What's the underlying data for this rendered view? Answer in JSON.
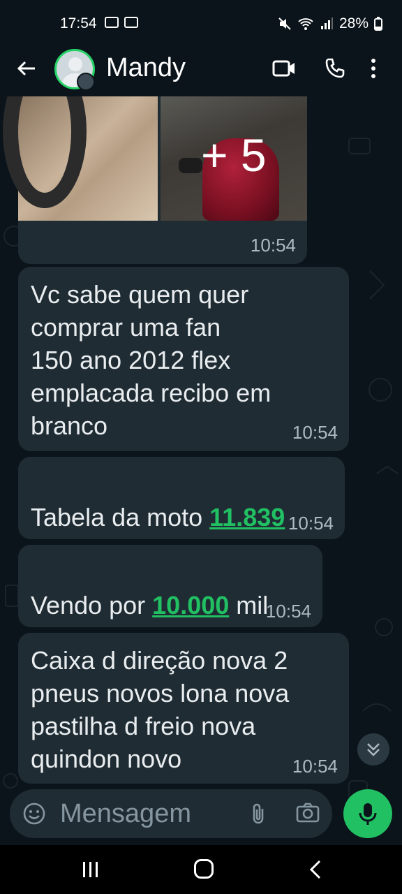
{
  "status_bar": {
    "time": "17:54",
    "battery": "28%"
  },
  "header": {
    "contact_name": "Mandy"
  },
  "album": {
    "more_count": "+ 5",
    "time": "10:54"
  },
  "messages": [
    {
      "text": "Vc sabe quem quer\ncomprar  uma fan\n150 ano 2012 flex\nemplacada recibo  em\nbranco",
      "time": "10:54"
    },
    {
      "prefix": "Tabela da moto ",
      "link": "11.839",
      "suffix": "",
      "time": "10:54"
    },
    {
      "prefix": "Vendo por ",
      "link": "10.000",
      "suffix": " mil",
      "time": "10:54"
    },
    {
      "text": "Caixa d direção nova 2\npneus novos lona nova\npastilha d freio nova\nquindon novo",
      "time": "10:54"
    }
  ],
  "composer": {
    "placeholder": "Mensagem"
  },
  "colors": {
    "accent": "#21c063",
    "bubble": "#1f2c34",
    "background": "#0b141a"
  },
  "icons": [
    "back-arrow-icon",
    "video-call-icon",
    "phone-icon",
    "more-options-icon",
    "emoji-icon",
    "attach-icon",
    "camera-icon",
    "mic-icon",
    "scroll-down-icon",
    "nav-recents-icon",
    "nav-home-icon",
    "nav-back-icon"
  ]
}
